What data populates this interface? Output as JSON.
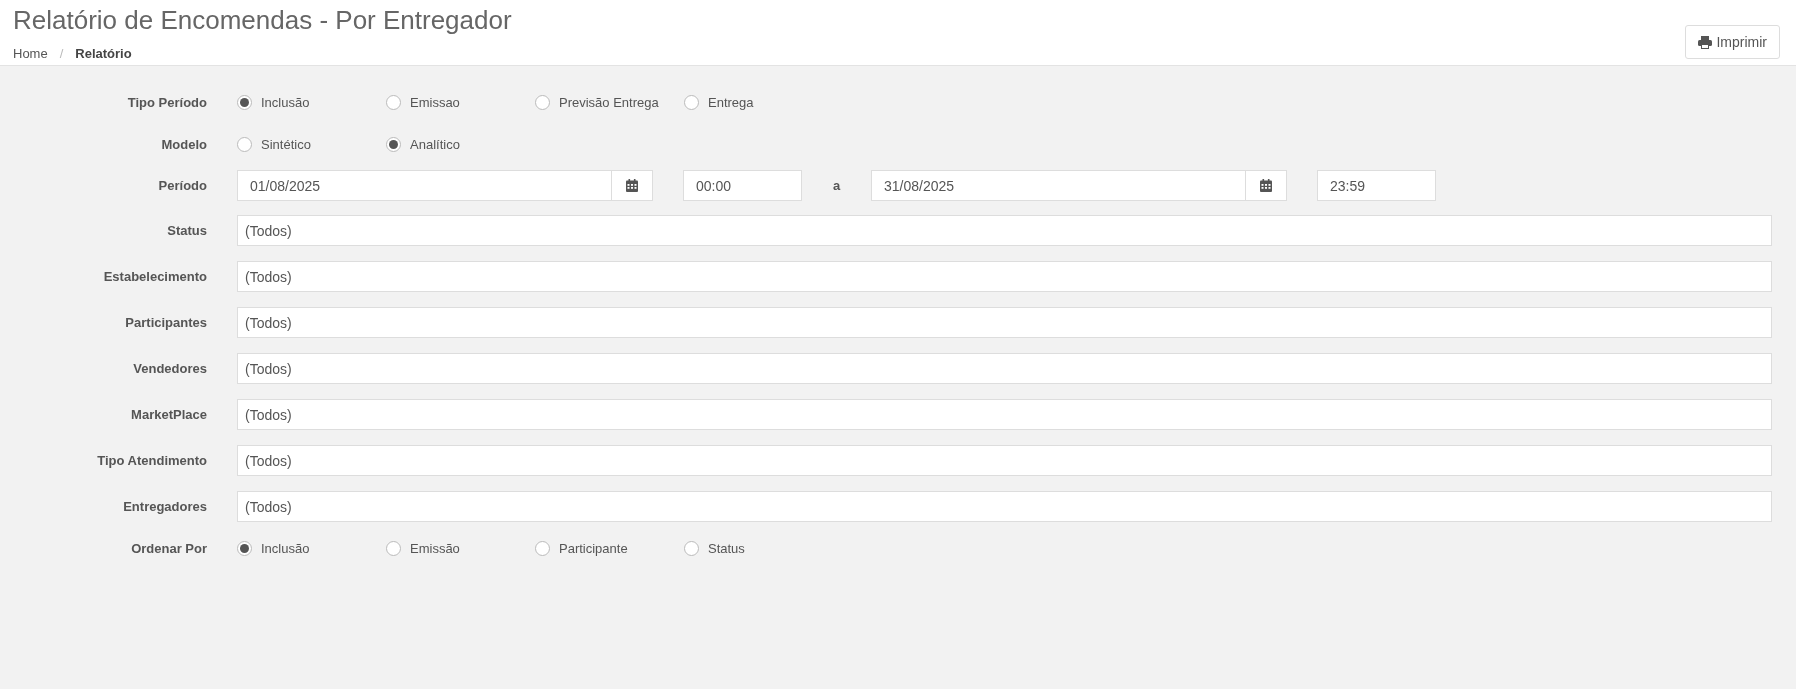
{
  "header": {
    "title": "Relatório de Encomendas - Por Entregador",
    "breadcrumb_separator": "/",
    "breadcrumb": [
      {
        "label": "Home",
        "current": false
      },
      {
        "label": "Relatório",
        "current": true
      }
    ],
    "print_button": "Imprimir"
  },
  "form": [
    {
      "kind": "radio",
      "label": "Tipo Período",
      "options": [
        {
          "label": "Inclusão",
          "selected": true
        },
        {
          "label": "Emissao",
          "selected": false
        },
        {
          "label": "Previsão Entrega",
          "selected": false
        },
        {
          "label": "Entrega",
          "selected": false
        }
      ]
    },
    {
      "kind": "radio",
      "label": "Modelo",
      "options": [
        {
          "label": "Sintético",
          "selected": false
        },
        {
          "label": "Analítico",
          "selected": true
        }
      ]
    },
    {
      "kind": "period",
      "label": "Período",
      "start_date": "01/08/2025",
      "start_time": "00:00",
      "separator": "a",
      "end_date": "31/08/2025",
      "end_time": "23:59"
    },
    {
      "kind": "select",
      "label": "Status",
      "value": "(Todos)"
    },
    {
      "kind": "select",
      "label": "Estabelecimento",
      "value": "(Todos)"
    },
    {
      "kind": "select",
      "label": "Participantes",
      "value": "(Todos)"
    },
    {
      "kind": "select",
      "label": "Vendedores",
      "value": "(Todos)"
    },
    {
      "kind": "select",
      "label": "MarketPlace",
      "value": "(Todos)"
    },
    {
      "kind": "select",
      "label": "Tipo Atendimento",
      "value": "(Todos)"
    },
    {
      "kind": "select",
      "label": "Entregadores",
      "value": "(Todos)"
    },
    {
      "kind": "radio",
      "label": "Ordenar Por",
      "options": [
        {
          "label": "Inclusão",
          "selected": true
        },
        {
          "label": "Emissão",
          "selected": false
        },
        {
          "label": "Participante",
          "selected": false
        },
        {
          "label": "Status",
          "selected": false
        }
      ]
    }
  ]
}
